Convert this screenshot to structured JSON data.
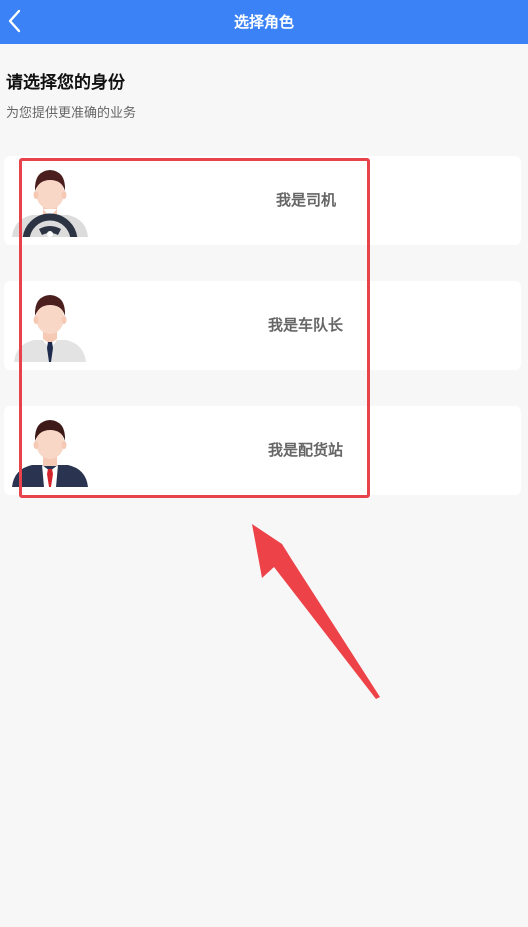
{
  "header": {
    "title": "选择角色",
    "back_icon": "chevron-left-icon"
  },
  "intro": {
    "heading": "请选择您的身份",
    "subheading": "为您提供更准确的业务"
  },
  "roles": [
    {
      "label": "我是司机",
      "avatar": "driver-avatar-icon"
    },
    {
      "label": "我是车队长",
      "avatar": "fleet-captain-avatar-icon"
    },
    {
      "label": "我是配货站",
      "avatar": "dispatch-station-avatar-icon"
    }
  ],
  "annotation": {
    "highlight_color": "#e8434b",
    "arrow_color": "#ee4249"
  },
  "colors": {
    "header_bg": "#3a82f5",
    "page_bg": "#f7f7f8"
  }
}
